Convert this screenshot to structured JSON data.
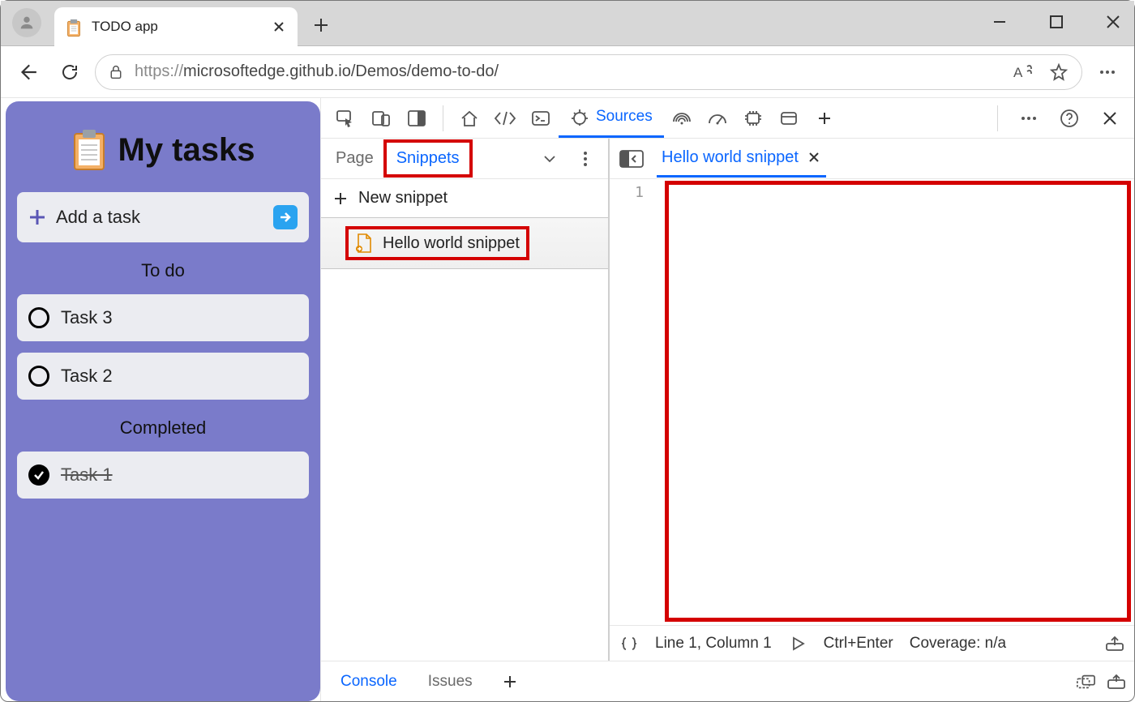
{
  "browser": {
    "tab_title": "TODO app",
    "url_scheme": "https://",
    "url_rest": "microsoftedge.github.io/Demos/demo-to-do/"
  },
  "app": {
    "title": "My tasks",
    "add_label": "Add a task",
    "todo_header": "To do",
    "completed_header": "Completed",
    "todo_items": [
      "Task 3",
      "Task 2"
    ],
    "completed_items": [
      "Task 1"
    ]
  },
  "devtools": {
    "active_panel": "Sources",
    "nav": {
      "tabs": {
        "page": "Page",
        "snippets": "Snippets"
      },
      "new_snippet_label": "New snippet",
      "snippets": [
        "Hello world snippet"
      ]
    },
    "editor": {
      "open_tab": "Hello world snippet",
      "gutter_first_line": "1",
      "status": {
        "position": "Line 1, Column 1",
        "run_hint": "Ctrl+Enter",
        "coverage": "Coverage: n/a"
      }
    },
    "drawer": {
      "console": "Console",
      "issues": "Issues"
    }
  }
}
